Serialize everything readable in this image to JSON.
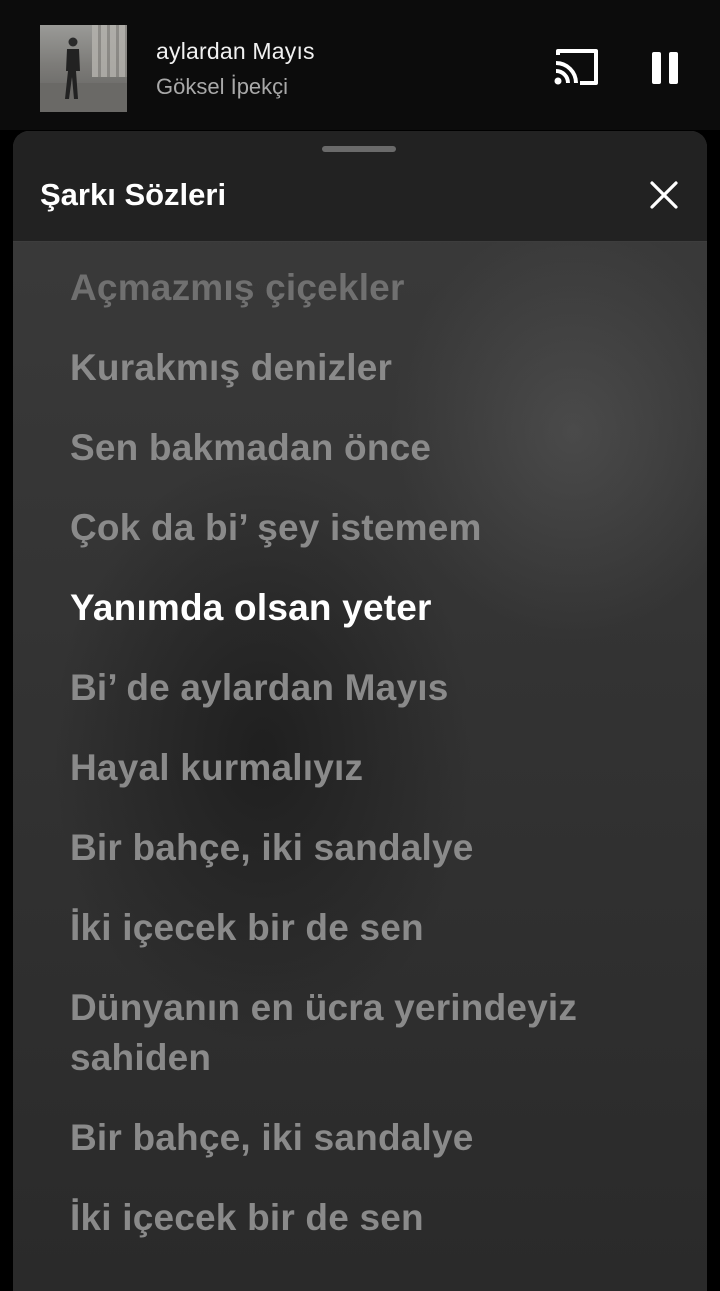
{
  "now_playing": {
    "title": "aylardan Mayıs",
    "artist": "Göksel İpekçi"
  },
  "icons": {
    "cast": "cast-icon",
    "pause": "pause-icon",
    "close": "close-icon"
  },
  "lyrics_sheet": {
    "title": "Şarkı Sözleri",
    "lines": [
      "Açmazmış çiçekler",
      "Kurakmış denizler",
      "Sen bakmadan önce",
      "Çok da bi’ şey istemem",
      "Yanımda olsan yeter",
      "Bi’ de aylardan Mayıs",
      "Hayal kurmalıyız",
      "Bir bahçe, iki sandalye",
      "İki içecek bir de sen",
      "Dünyanın en ücra yerindeyiz sahiden",
      "Bir bahçe, iki sandalye",
      "İki içecek bir de sen"
    ],
    "active_line_index": 4
  },
  "colors": {
    "active_lyric": "#ffffff",
    "inactive_lyric": "#8a8a8a",
    "sheet_background": "#343434"
  }
}
